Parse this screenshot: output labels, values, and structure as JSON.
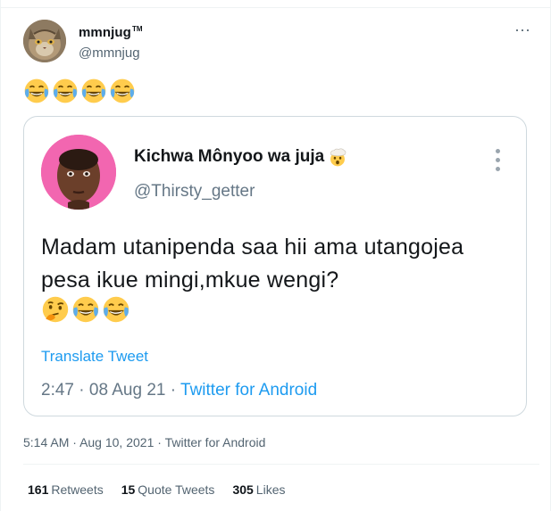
{
  "author": {
    "display_name": "mmnjug",
    "name_suffix": "TM",
    "handle": "@mmnjug"
  },
  "tweet": {
    "emojis": [
      "face-with-tears-of-joy",
      "face-with-tears-of-joy",
      "face-with-tears-of-joy",
      "face-with-tears-of-joy"
    ]
  },
  "quote": {
    "display_name": "Kichwa Mônyoo wa juja",
    "name_emoji": "exploding-head",
    "handle": "@Thirsty_getter",
    "text": "Madam utanipenda saa hii ama utangojea pesa ikue mingi,mkue wengi?",
    "emojis": [
      "thinking-face",
      "face-with-tears-of-joy",
      "face-with-tears-of-joy"
    ],
    "translate_label": "Translate Tweet",
    "time": "2:47",
    "date": "08 Aug 21",
    "source": "Twitter for Android",
    "separator": "·"
  },
  "footer": {
    "time": "5:14 AM",
    "date": "Aug 10, 2021",
    "source": "Twitter for Android",
    "separator": "·"
  },
  "stats": {
    "retweets_count": "161",
    "retweets_label": "Retweets",
    "quotes_count": "15",
    "quotes_label": "Quote Tweets",
    "likes_count": "305",
    "likes_label": "Likes"
  },
  "colors": {
    "link_blue": "#1d9bf0",
    "secondary_text": "#536471",
    "border": "#cfd9de"
  }
}
